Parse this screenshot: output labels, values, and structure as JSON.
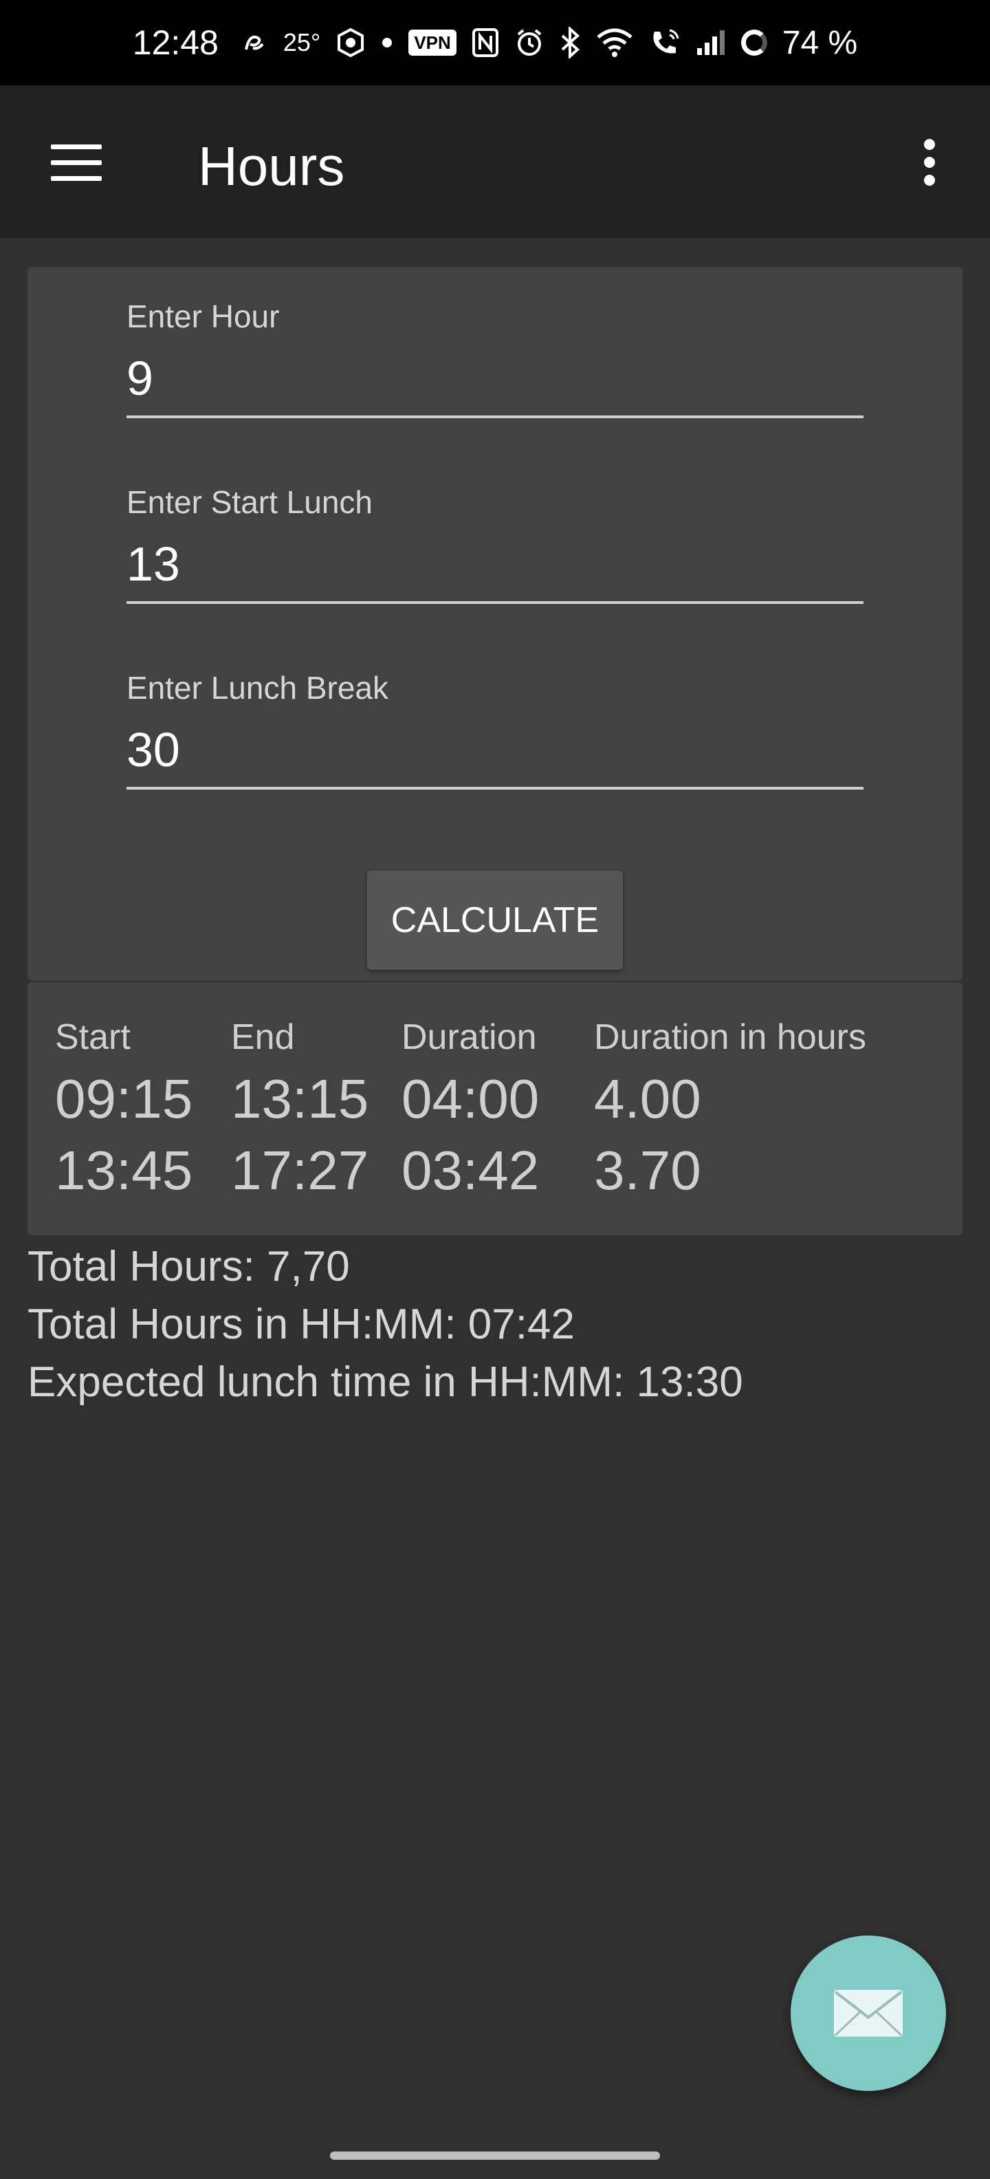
{
  "status_bar": {
    "time": "12:48",
    "temperature": "25°",
    "vpn": "VPN",
    "battery": "74 %"
  },
  "app_bar": {
    "title": "Hours"
  },
  "form": {
    "hour": {
      "label": "Enter Hour",
      "value": "9"
    },
    "start_lunch": {
      "label": "Enter Start Lunch",
      "value": "13"
    },
    "lunch_break": {
      "label": "Enter Lunch Break",
      "value": "30"
    },
    "calculate_label": "CALCULATE"
  },
  "results": {
    "headers": [
      "Start",
      "End",
      "Duration",
      "Duration in hours"
    ],
    "rows": [
      [
        "09:15",
        "13:15",
        "04:00",
        "4.00"
      ],
      [
        "13:45",
        "17:27",
        "03:42",
        "3.70"
      ]
    ]
  },
  "totals": {
    "total_hours": "Total Hours: 7,70",
    "total_hhmm": "Total Hours in HH:MM: 07:42",
    "expected_lunch": "Expected lunch time in HH:MM: 13:30"
  },
  "colors": {
    "background": "#303030",
    "app_bar": "#212121",
    "card": "#424242",
    "fab": "#80cbc4"
  },
  "icons": {
    "menu": "menu-icon",
    "overflow": "more-vert-icon",
    "fab": "email-icon"
  }
}
